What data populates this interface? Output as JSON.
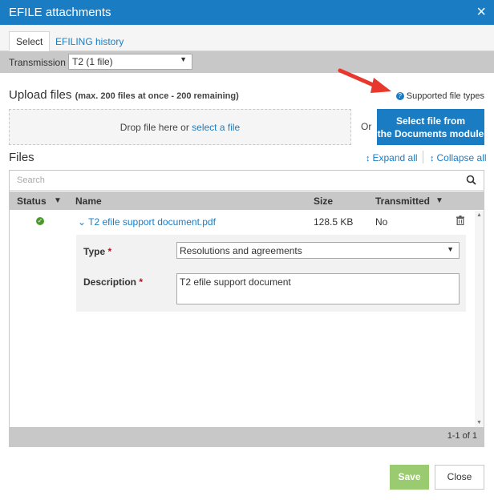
{
  "dialog": {
    "title": "EFILE attachments",
    "close_glyph": "×"
  },
  "tabs": [
    {
      "label": "Select",
      "active": true
    },
    {
      "label": "EFILING history",
      "active": false
    }
  ],
  "transmission": {
    "label": "Transmission",
    "value": "T2 (1 file)"
  },
  "upload": {
    "title": "Upload files",
    "subtitle": "(max. 200 files at once - 200 remaining)",
    "supported_types": "Supported file types",
    "drop_text": "Drop file here or",
    "select_link": "select a file",
    "or_text": "Or",
    "doc_button_line1": "Select file from",
    "doc_button_line2": "the Documents module"
  },
  "files": {
    "title": "Files",
    "expand_all": "Expand all",
    "collapse_all": "Collapse all",
    "search_placeholder": "Search",
    "columns": {
      "status": "Status",
      "name": "Name",
      "size": "Size",
      "transmitted": "Transmitted"
    },
    "rows": [
      {
        "name": "T2 efile support document.pdf",
        "size": "128.5 KB",
        "transmitted": "No",
        "type_label": "Type",
        "type_value": "Resolutions and agreements",
        "description_label": "Description",
        "description_value": "T2 efile support document"
      }
    ],
    "pager": "1-1 of 1"
  },
  "buttons": {
    "save": "Save",
    "close": "Close"
  },
  "colors": {
    "accent": "#1a7dc4",
    "save": "#9bcb70",
    "ok": "#4a9a2b",
    "required": "#d0021b",
    "annotation_arrow": "#e8372c"
  }
}
